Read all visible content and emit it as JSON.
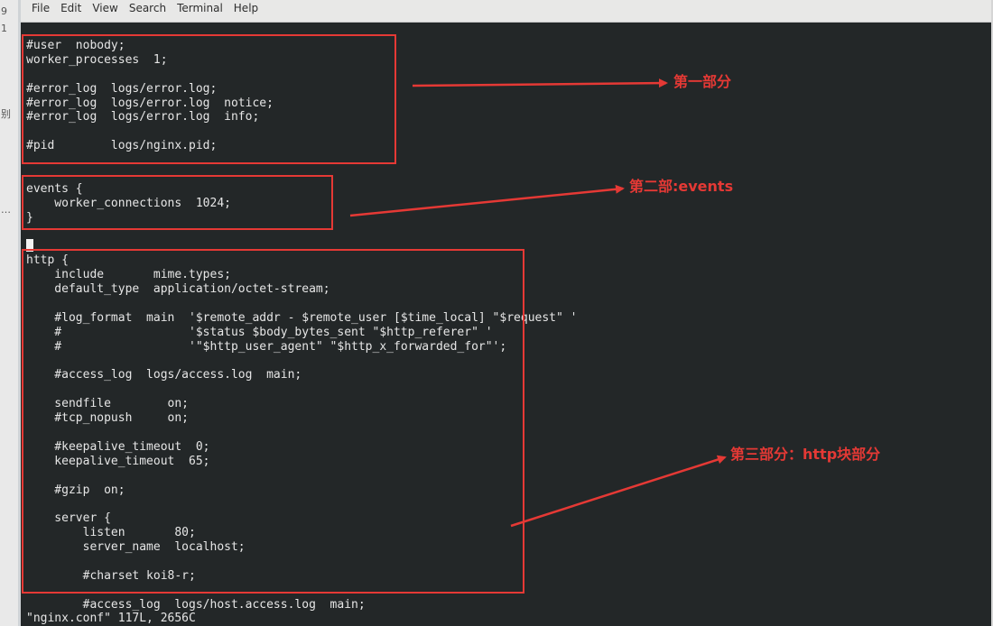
{
  "background_app": {
    "fragments": [
      "9",
      "1",
      "别",
      "…"
    ]
  },
  "menubar": {
    "items": [
      "File",
      "Edit",
      "View",
      "Search",
      "Terminal",
      "Help"
    ]
  },
  "terminal": {
    "lines": [
      "#user  nobody;",
      "worker_processes  1;",
      "",
      "#error_log  logs/error.log;",
      "#error_log  logs/error.log  notice;",
      "#error_log  logs/error.log  info;",
      "",
      "#pid        logs/nginx.pid;",
      "",
      "",
      "events {",
      "    worker_connections  1024;",
      "}",
      "",
      "",
      "http {",
      "    include       mime.types;",
      "    default_type  application/octet-stream;",
      "",
      "    #log_format  main  '$remote_addr - $remote_user [$time_local] \"$request\" '",
      "    #                  '$status $body_bytes_sent \"$http_referer\" '",
      "    #                  '\"$http_user_agent\" \"$http_x_forwarded_for\"';",
      "",
      "    #access_log  logs/access.log  main;",
      "",
      "    sendfile        on;",
      "    #tcp_nopush     on;",
      "",
      "    #keepalive_timeout  0;",
      "    keepalive_timeout  65;",
      "",
      "    #gzip  on;",
      "",
      "    server {",
      "        listen       80;",
      "        server_name  localhost;",
      "",
      "        #charset koi8-r;",
      "",
      "        #access_log  logs/host.access.log  main;"
    ],
    "status": "\"nginx.conf\" 117L, 2656C"
  },
  "annotations": {
    "part1": "第一部分",
    "part2": "第二部:events",
    "part3": "第三部分：http块部分",
    "color": "#e53935"
  }
}
